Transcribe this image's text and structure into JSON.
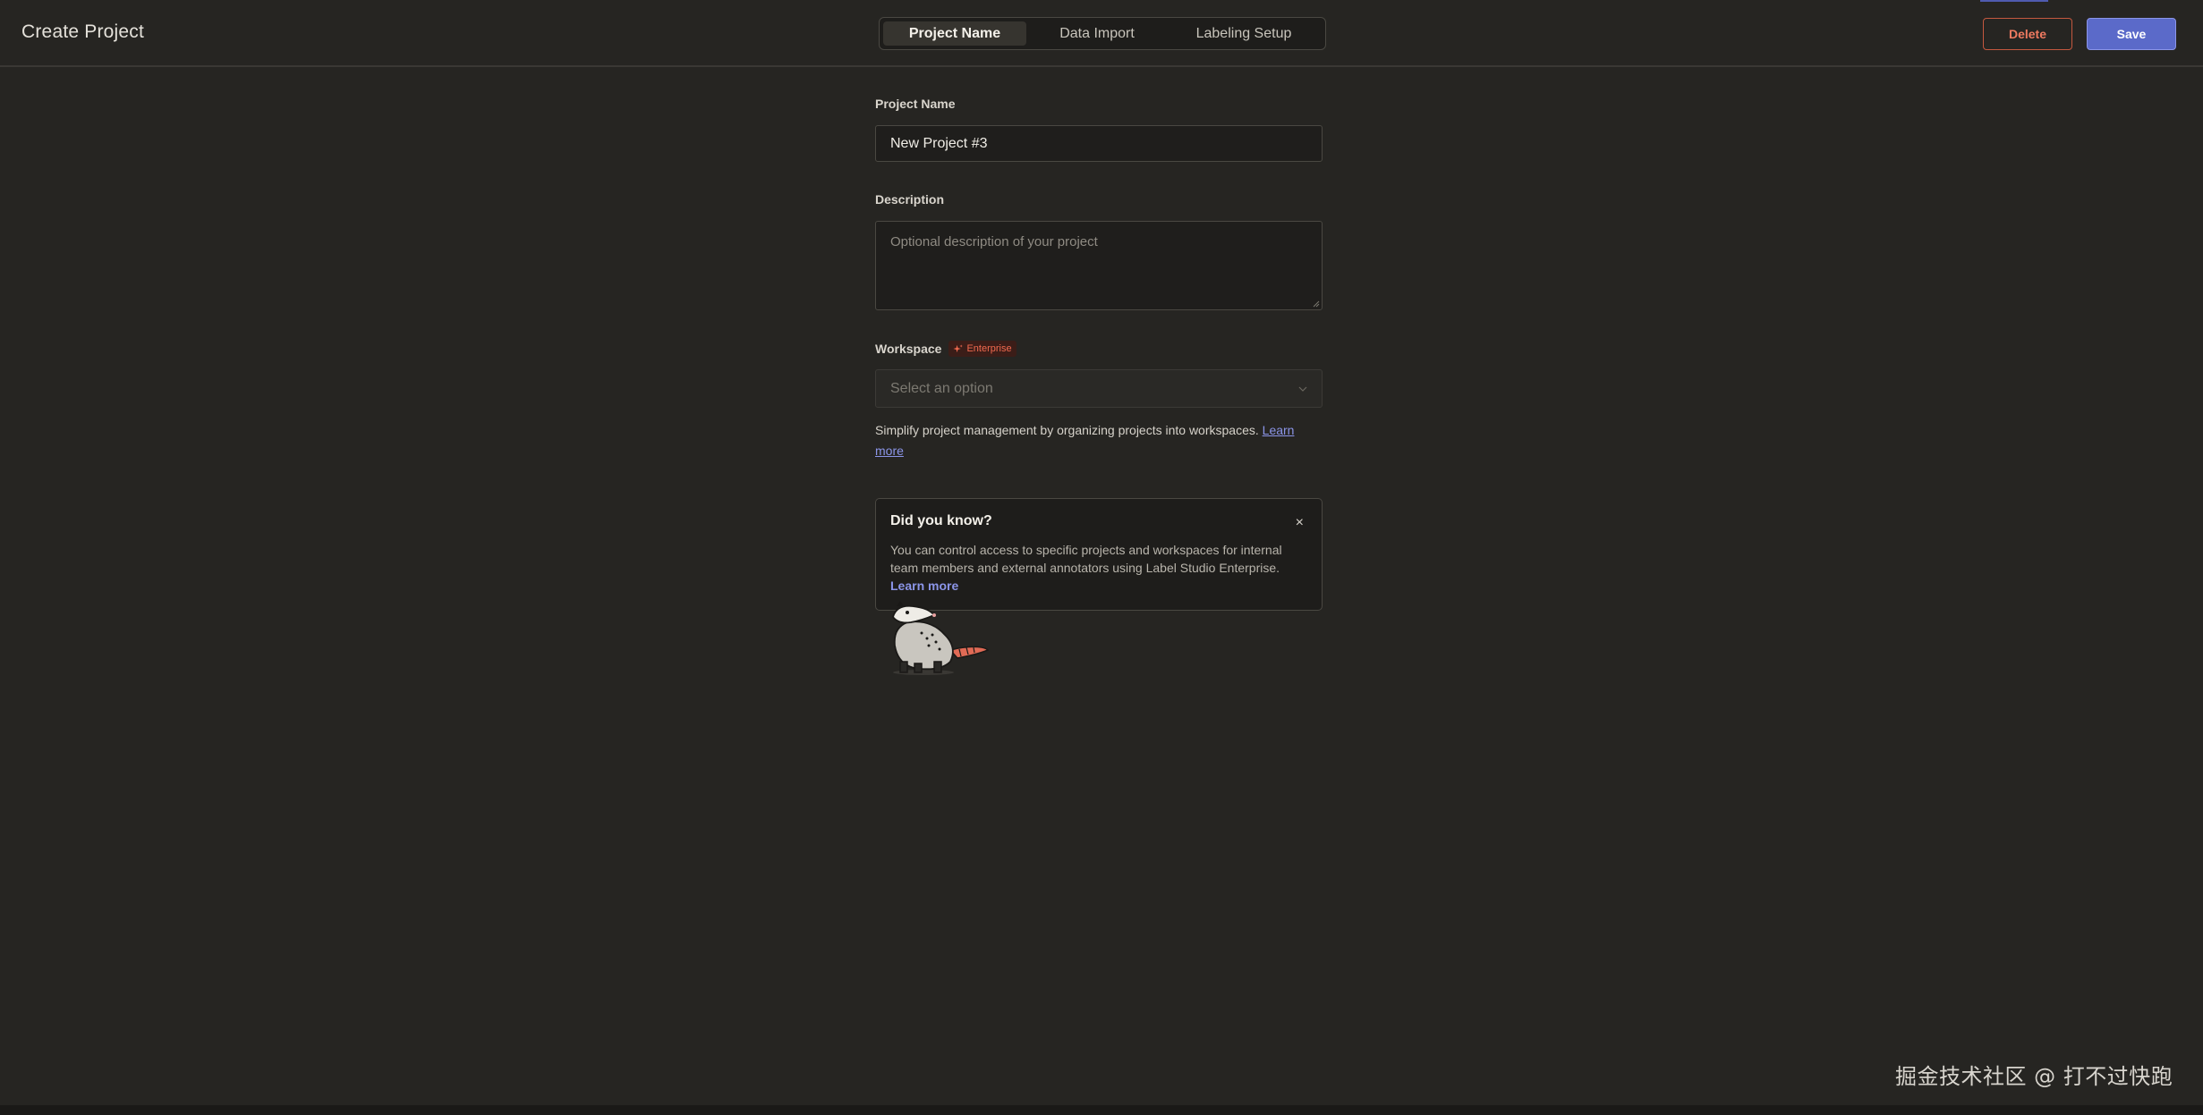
{
  "header": {
    "title": "Create Project",
    "steps": [
      "Project Name",
      "Data Import",
      "Labeling Setup"
    ],
    "active_step": "Project Name",
    "delete_label": "Delete",
    "save_label": "Save"
  },
  "form": {
    "name_label": "Project Name",
    "name_value": "New Project #3",
    "description_label": "Description",
    "description_placeholder": "Optional description of your project",
    "workspace_label": "Workspace",
    "enterprise_badge": "Enterprise",
    "workspace_placeholder": "Select an option",
    "workspace_help": "Simplify project management by organizing projects into workspaces.",
    "workspace_help_link": "Learn more"
  },
  "tip": {
    "title": "Did you know?",
    "close": "×",
    "body": "You can control access to specific projects and workspaces for internal team members and external annotators using Label Studio Enterprise.",
    "link": "Learn more"
  },
  "watermark": "掘金技术社区 @ 打不过快跑",
  "colors": {
    "background": "#262522",
    "accent": "#5b6ac9",
    "danger": "#ef7a60",
    "link": "#8b95e8"
  },
  "icons": {
    "enterprise_badge": "sparkle-icon",
    "select": "chevron-down-icon",
    "close": "close-icon",
    "mascot": "opossum-mascot-icon"
  }
}
